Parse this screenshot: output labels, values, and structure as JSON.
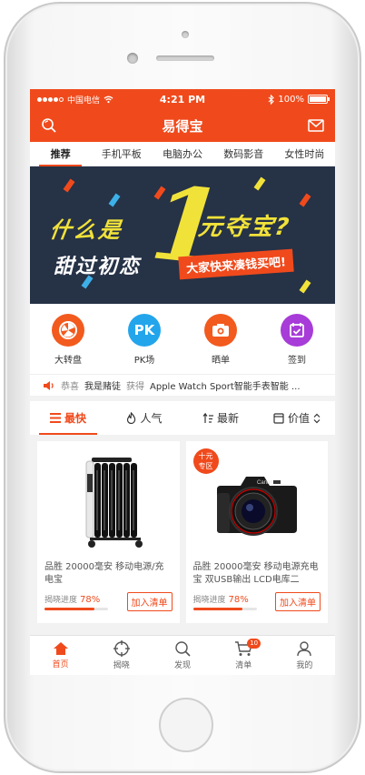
{
  "status": {
    "carrier": "中国电信",
    "time": "4:21 PM",
    "battery": "100%"
  },
  "nav": {
    "title": "易得宝"
  },
  "tabs": [
    {
      "label": "推荐"
    },
    {
      "label": "手机平板"
    },
    {
      "label": "电脑办公"
    },
    {
      "label": "数码影音"
    },
    {
      "label": "女性时尚"
    }
  ],
  "banner": {
    "line1": "什么是",
    "digit": "1",
    "line2": "元夺宝?",
    "line3": "甜过初恋",
    "pill": "大家快来凑钱买吧!"
  },
  "quick": [
    {
      "label": "大转盘",
      "color": "#f25a1e",
      "icon": "wheel-icon"
    },
    {
      "label": "PK场",
      "color": "#23a5ec",
      "icon_text": "PK"
    },
    {
      "label": "晒单",
      "color": "#f25a1e",
      "icon": "camera-icon"
    },
    {
      "label": "签到",
      "color": "#a73cd8",
      "icon": "checkin-icon"
    }
  ],
  "notice": {
    "prefix": "恭喜",
    "user": "我是赌徒",
    "verb": "获得",
    "product": "Apple Watch Sport智能手表智能 ..."
  },
  "sort": [
    {
      "label": "最快"
    },
    {
      "label": "人气"
    },
    {
      "label": "最新"
    },
    {
      "label": "价值"
    }
  ],
  "products": [
    {
      "name": "品胜 20000毫安 移动电源/充电宝",
      "progress_label": "揭晓进度",
      "progress_pct": "78%",
      "progress": 0.78,
      "add_label": "加入清单"
    },
    {
      "name": "品胜 20000毫安 移动电源充电宝 双USB输出 LCD电库二",
      "progress_label": "揭晓进度",
      "progress_pct": "78%",
      "progress": 0.78,
      "add_label": "加入清单",
      "badge": [
        "十元",
        "专区"
      ]
    }
  ],
  "tabbar": [
    {
      "label": "首页",
      "icon": "home-icon"
    },
    {
      "label": "揭晓",
      "icon": "target-icon"
    },
    {
      "label": "发现",
      "icon": "search-icon"
    },
    {
      "label": "清单",
      "icon": "cart-icon",
      "count": "10"
    },
    {
      "label": "我的",
      "icon": "user-icon"
    }
  ]
}
